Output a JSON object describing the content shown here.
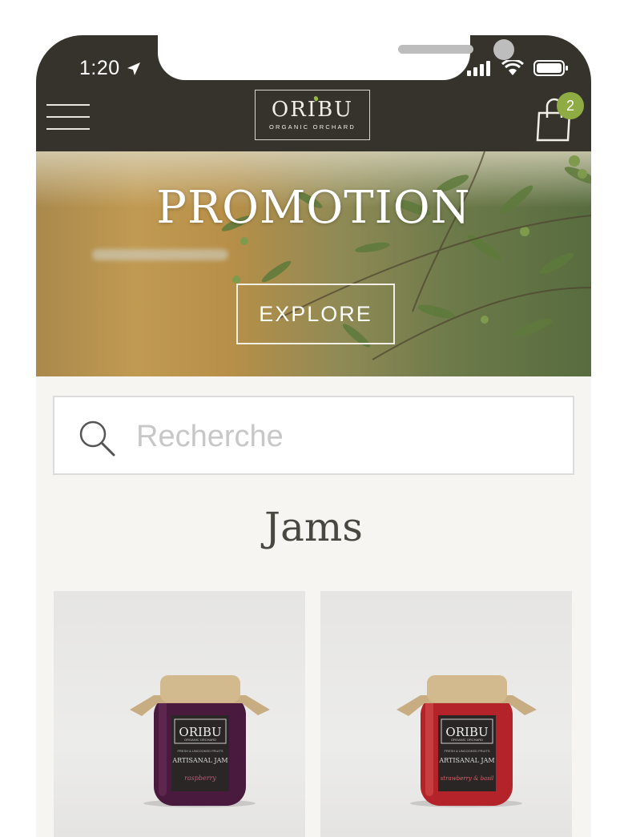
{
  "status_bar": {
    "time": "1:20"
  },
  "header": {
    "logo": {
      "name": "ORIBU",
      "tagline": "ORGANIC ORCHARD"
    },
    "cart_count": "2"
  },
  "hero": {
    "title": "PROMOTION",
    "button_label": "EXPLORE"
  },
  "search": {
    "placeholder": "Recherche"
  },
  "section": {
    "title": "Jams"
  },
  "products": [
    {
      "brand": "ORIBU",
      "brand_sub": "ORGANIC ORCHARD",
      "line": "FRESH & UNCOOKED FRUITS",
      "product": "ARTISANAL JAM",
      "flavor": "raspberry",
      "jar_color": "#4a1a3e"
    },
    {
      "brand": "ORIBU",
      "brand_sub": "ORGANIC ORCHARD",
      "line": "FRESH & UNCOOKED FRUITS",
      "product": "ARTISANAL JAM",
      "flavor": "strawberry & basil",
      "jar_color": "#b5232a"
    }
  ],
  "colors": {
    "header_bg": "#35332b",
    "accent_green": "#8eab44",
    "page_bg": "#f6f5f1"
  }
}
